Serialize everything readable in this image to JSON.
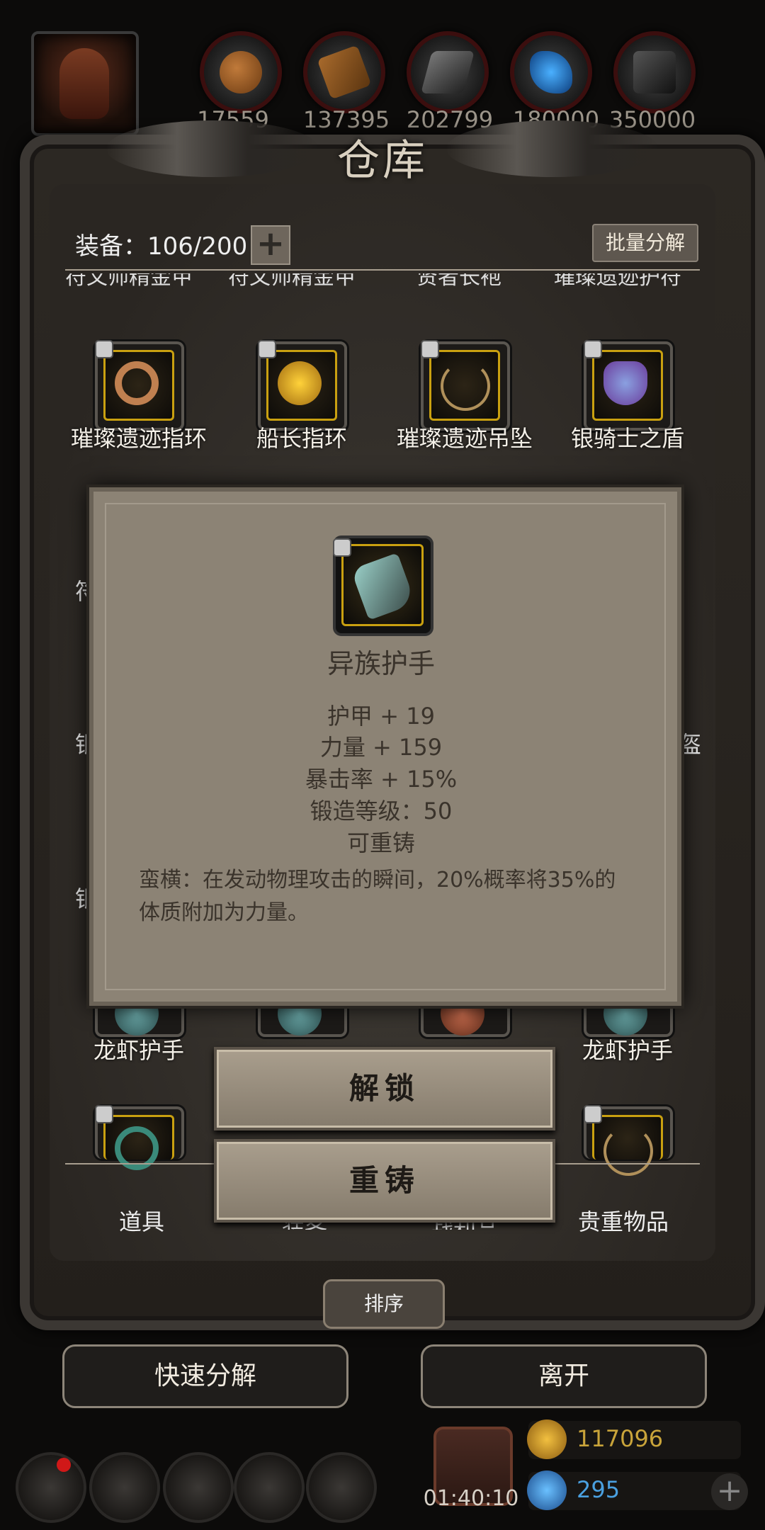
{
  "colors": {
    "gold_frame": "#c9a010",
    "panel_bg": "#2c2823",
    "popup_bg": "#8c8375",
    "popup_text": "#3a332b",
    "gold_text": "#c9a43a",
    "diamond_text": "#4aa0e0"
  },
  "resources": [
    {
      "icon": "wood-log-icon",
      "value": "17559"
    },
    {
      "icon": "lumber-plank-icon",
      "value": "137395"
    },
    {
      "icon": "iron-ingot-icon",
      "value": "202799"
    },
    {
      "icon": "crystal-shard-icon",
      "value": "180000"
    },
    {
      "icon": "ore-icon",
      "value": "350000"
    }
  ],
  "header": {
    "title": "仓库"
  },
  "toolbar": {
    "equip_label": "装备：106/200",
    "plus_label": "+",
    "batch_label": "批量分解"
  },
  "grid": {
    "cut_row": [
      "符文师精金甲",
      "符文师精金甲",
      "贤者长袍",
      "璀璨遗迹护符"
    ],
    "row1": [
      {
        "name": "璀璨遗迹指环",
        "icon": "ring-icon"
      },
      {
        "name": "船长指环",
        "icon": "gem-ring-icon"
      },
      {
        "name": "璀璨遗迹吊坠",
        "icon": "necklace-icon"
      },
      {
        "name": "银骑士之盾",
        "icon": "shield-icon"
      }
    ],
    "side_left": [
      "符",
      "银",
      "银"
    ],
    "side_right": [
      "盔"
    ],
    "row_gauntlet": [
      "龙虾护手",
      "龙虾护手"
    ]
  },
  "popup": {
    "item_name": "异族护手",
    "item_icon": "gauntlet-icon",
    "stats": [
      "护甲 + 19",
      "力量 + 159",
      "暴击率 + 15%",
      "锻造等级：50",
      "可重铸"
    ],
    "description": "蛮横：在发动物理攻击的瞬间，20%概率将35%的体质附加为力量。"
  },
  "actions": {
    "unlock": "解锁",
    "reforge": "重铸"
  },
  "tabs": [
    "道具",
    "装备",
    "战利品",
    "贵重物品"
  ],
  "sort_label": "排序",
  "bottom_buttons": {
    "quick_decompose": "快速分解",
    "leave": "离开"
  },
  "footer": {
    "timer": "01:40:10",
    "gold": "117096",
    "diamonds": "295",
    "icons": [
      "settings-icon",
      "achievement-icon",
      "map-icon",
      "mail-icon",
      "guild-icon"
    ]
  }
}
